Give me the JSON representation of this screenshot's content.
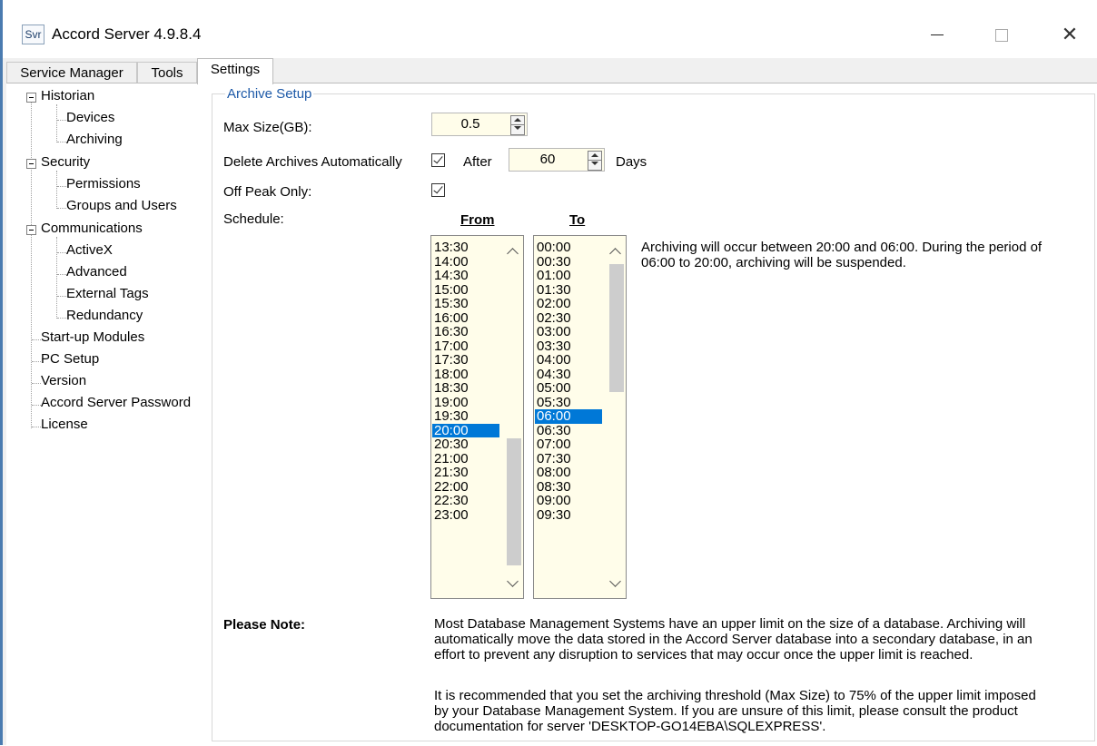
{
  "window": {
    "icon_text": "Svr",
    "title": "Accord Server 4.9.8.4"
  },
  "tabs": [
    {
      "label": "Service Manager"
    },
    {
      "label": "Tools"
    },
    {
      "label": "Settings"
    }
  ],
  "tree": {
    "historian": "Historian",
    "devices": "Devices",
    "archiving": "Archiving",
    "security": "Security",
    "permissions": "Permissions",
    "groups_users": "Groups and Users",
    "communications": "Communications",
    "activex": "ActiveX",
    "advanced": "Advanced",
    "external_tags": "External Tags",
    "redundancy": "Redundancy",
    "startup_modules": "Start-up Modules",
    "pc_setup": "PC Setup",
    "version": "Version",
    "password": "Accord Server Password",
    "license": "License"
  },
  "archive": {
    "group_title": "Archive Setup",
    "max_size_label": "Max Size(GB):",
    "max_size_value": "0.5",
    "delete_label": "Delete Archives Automatically",
    "delete_checked": true,
    "after_label": "After",
    "days_value": "60",
    "days_label": "Days",
    "offpeak_label": "Off Peak Only:",
    "offpeak_checked": true,
    "schedule_label": "Schedule:",
    "from_header": "From",
    "to_header": "To",
    "from_items": [
      "13:30",
      "14:00",
      "14:30",
      "15:00",
      "15:30",
      "16:00",
      "16:30",
      "17:00",
      "17:30",
      "18:00",
      "18:30",
      "19:00",
      "19:30",
      "20:00",
      "20:30",
      "21:00",
      "21:30",
      "22:00",
      "22:30",
      "23:00"
    ],
    "from_selected": "20:00",
    "to_items": [
      "00:00",
      "00:30",
      "01:00",
      "01:30",
      "02:00",
      "02:30",
      "03:00",
      "03:30",
      "04:00",
      "04:30",
      "05:00",
      "05:30",
      "06:00",
      "06:30",
      "07:00",
      "07:30",
      "08:00",
      "08:30",
      "09:00",
      "09:30"
    ],
    "to_selected": "06:00",
    "schedule_note_1": "Archiving will occur between 20:00 and 06:00.  During the period of",
    "schedule_note_2": "06:00 to 20:00, archiving will be suspended.",
    "please_note_label": "Please Note:",
    "note_p1_l1": "Most Database Management Systems have an upper limit on the size of a database.  Archiving will",
    "note_p1_l2": "automatically move the data stored in the Accord Server database into a secondary database, in an",
    "note_p1_l3": "effort to prevent any disruption to services that may occur once the upper limit is reached.",
    "note_p2_l1": "It is recommended that you set the archiving threshold (Max Size) to 75% of the upper limit imposed",
    "note_p2_l2": "by your Database Management System.  If you are unsure of this limit, please consult the product",
    "note_p2_l3": "documentation for server 'DESKTOP-GO14EBA\\SQLEXPRESS'."
  }
}
